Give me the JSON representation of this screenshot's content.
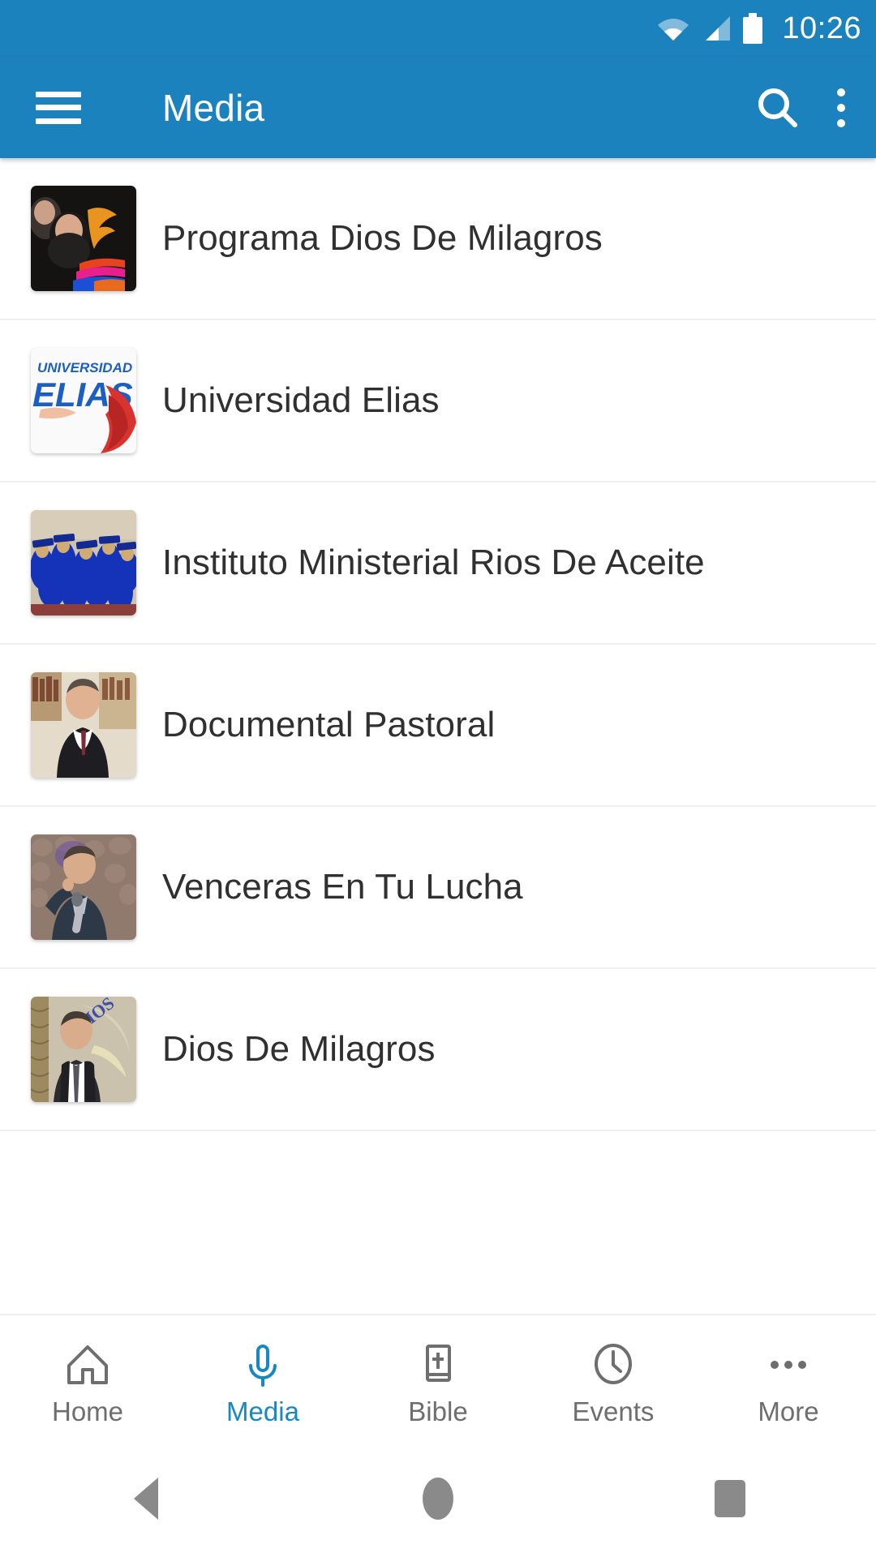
{
  "status_bar": {
    "time": "10:26",
    "icons": [
      "wifi-icon",
      "signal-icon",
      "battery-icon"
    ]
  },
  "toolbar": {
    "menu_icon": "hamburger-menu-icon",
    "title": "Media",
    "search_icon": "search-icon",
    "overflow_icon": "overflow-menu-icon",
    "background_color": "#1C82BD"
  },
  "media_list": {
    "items": [
      {
        "title": "Programa Dios De Milagros",
        "thumbnail": "woman-with-dios-de-milagros-logo-thumbnail"
      },
      {
        "title": "Universidad Elias",
        "thumbnail": "universidad-elias-logo-thumbnail"
      },
      {
        "title": "Instituto Ministerial Rios De Aceite",
        "thumbnail": "graduation-ceremony-thumbnail"
      },
      {
        "title": "Documental Pastoral",
        "thumbnail": "pastor-portrait-thumbnail"
      },
      {
        "title": "Venceras En Tu Lucha",
        "thumbnail": "preacher-with-microphone-thumbnail"
      },
      {
        "title": "Dios De Milagros",
        "thumbnail": "speaker-at-podium-thumbnail"
      }
    ]
  },
  "bottom_nav": {
    "active": "Media",
    "active_color": "#1888c4",
    "inactive_color": "#6e6e6e",
    "tabs": [
      {
        "label": "Home",
        "icon": "home-icon"
      },
      {
        "label": "Media",
        "icon": "microphone-icon"
      },
      {
        "label": "Bible",
        "icon": "bible-book-icon"
      },
      {
        "label": "Events",
        "icon": "clock-icon"
      },
      {
        "label": "More",
        "icon": "more-dots-icon"
      }
    ]
  },
  "system_nav": {
    "buttons": [
      {
        "name": "back",
        "icon": "back-triangle-icon"
      },
      {
        "name": "home",
        "icon": "home-circle-icon"
      },
      {
        "name": "recents",
        "icon": "recents-square-icon"
      }
    ]
  }
}
